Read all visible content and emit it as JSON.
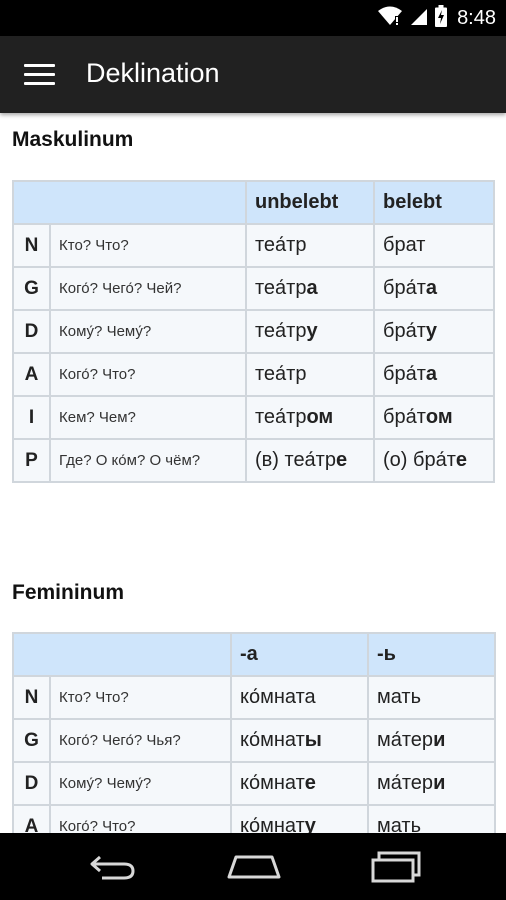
{
  "status": {
    "time": "8:48"
  },
  "appbar": {
    "title": "Deklination"
  },
  "masculine": {
    "title": "Maskulinum",
    "headers": [
      "unbelebt",
      "belebt"
    ],
    "rows": [
      {
        "case": "N",
        "question": "Кто? Что?",
        "c1": [
          "теа́тр",
          ""
        ],
        "c2": [
          "брат",
          ""
        ]
      },
      {
        "case": "G",
        "question": "Кого́? Чего́? Чей?",
        "c1": [
          "теа́тр",
          "а"
        ],
        "c2": [
          "бра́т",
          "а"
        ]
      },
      {
        "case": "D",
        "question": "Кому́? Чему́?",
        "c1": [
          "теа́тр",
          "у"
        ],
        "c2": [
          "бра́т",
          "у"
        ]
      },
      {
        "case": "A",
        "question": "Кого́? Что?",
        "c1": [
          "теа́тр",
          ""
        ],
        "c2": [
          "бра́т",
          "а"
        ]
      },
      {
        "case": "I",
        "question": "Кем? Чем?",
        "c1": [
          "теа́тр",
          "ом"
        ],
        "c2": [
          "бра́т",
          "ом"
        ]
      },
      {
        "case": "P",
        "question": "Где? О ко́м? О чём?",
        "c1": [
          "(в) теа́тр",
          "е"
        ],
        "c2": [
          "(о) бра́т",
          "е"
        ]
      }
    ]
  },
  "feminine": {
    "title": "Femininum",
    "headers": [
      "-а",
      "-ь"
    ],
    "rows": [
      {
        "case": "N",
        "question": "Кто? Что?",
        "c1": [
          "ко́мната",
          ""
        ],
        "c2": [
          "мать",
          ""
        ]
      },
      {
        "case": "G",
        "question": "Кого́? Чего́? Чья?",
        "c1": [
          "ко́мнат",
          "ы"
        ],
        "c2": [
          "ма́тер",
          "и"
        ]
      },
      {
        "case": "D",
        "question": "Кому́? Чему́?",
        "c1": [
          "ко́мнат",
          "е"
        ],
        "c2": [
          "ма́тер",
          "и"
        ]
      },
      {
        "case": "A",
        "question": "Кого́? Что?",
        "c1": [
          "ко́мнат",
          "у"
        ],
        "c2": [
          "мать",
          ""
        ]
      }
    ]
  },
  "icons": {
    "wifi": "wifi-icon",
    "signal": "signal-icon",
    "battery": "battery-icon",
    "menu": "hamburger-menu-icon",
    "back": "back-icon",
    "home": "home-icon",
    "recents": "recents-icon"
  },
  "colors": {
    "appbar": "#212121",
    "table_header": "#cfe5fb",
    "table_cell": "#f5f8fb"
  }
}
